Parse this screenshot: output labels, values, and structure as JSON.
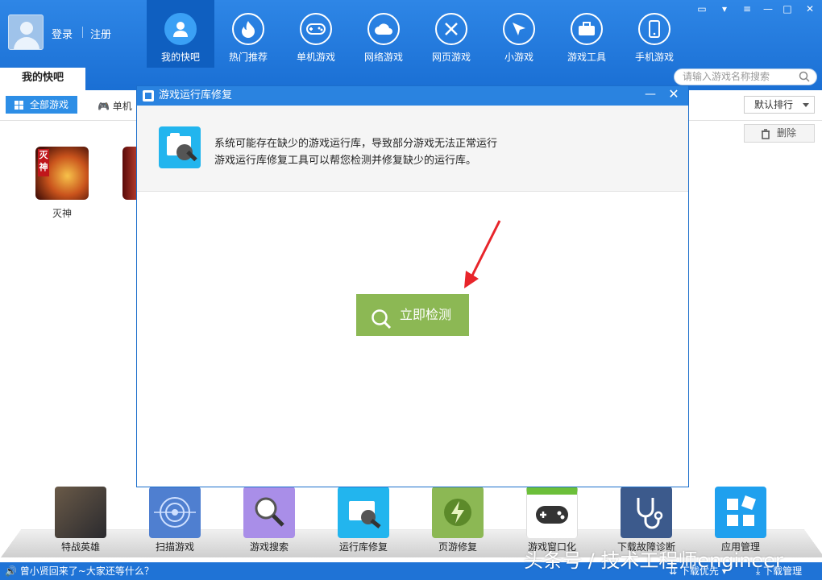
{
  "header": {
    "login": "登录",
    "register": "注册",
    "nav": [
      {
        "label": "我的快吧",
        "icon": "user-icon",
        "active": true
      },
      {
        "label": "热门推荐",
        "icon": "flame-icon"
      },
      {
        "label": "单机游戏",
        "icon": "gamepad-icon"
      },
      {
        "label": "网络游戏",
        "icon": "cloud-icon"
      },
      {
        "label": "网页游戏",
        "icon": "swords-icon"
      },
      {
        "label": "小游戏",
        "icon": "paper-plane-icon"
      },
      {
        "label": "游戏工具",
        "icon": "toolbox-icon"
      },
      {
        "label": "手机游戏",
        "icon": "phone-icon"
      }
    ],
    "window_controls": [
      "message-icon",
      "skin-icon",
      "menu-icon",
      "minimize-icon",
      "maximize-icon",
      "close-icon"
    ],
    "accent": "#1f73d6"
  },
  "tabs": {
    "active": "我的快吧"
  },
  "search": {
    "placeholder": "请输入游戏名称搜索"
  },
  "filter": {
    "all_games": "全部游戏",
    "single": "单机",
    "sort": "默认排行",
    "delete": "删除"
  },
  "games": [
    {
      "name": "灭神",
      "badge": "灭神"
    }
  ],
  "dialog": {
    "title": "游戏运行库修复",
    "line1": "系统可能存在缺少的游戏运行库，导致部分游戏无法正常运行",
    "line2": "游戏运行库修复工具可以帮您检测并修复缺少的运行库。",
    "button": "立即检测",
    "button_color": "#8cb854"
  },
  "dock": [
    {
      "label": "特战英雄",
      "color": "#4a4f57"
    },
    {
      "label": "扫描游戏",
      "color": "#4f7fd0"
    },
    {
      "label": "游戏搜索",
      "color": "#a98ee8"
    },
    {
      "label": "运行库修复",
      "color": "#22b5ee"
    },
    {
      "label": "页游修复",
      "color": "#8cb854"
    },
    {
      "label": "游戏窗口化",
      "color": "#9ecc4a"
    },
    {
      "label": "下载故障诊断",
      "color": "#3c5a8c"
    },
    {
      "label": "应用管理",
      "color": "#1fa0ee"
    }
  ],
  "status": {
    "message": "曾小贤回来了~大家还等什么？",
    "priority": "下载优先",
    "manager": "下载管理"
  },
  "watermark": "头条号 / 技术工程师engineer"
}
